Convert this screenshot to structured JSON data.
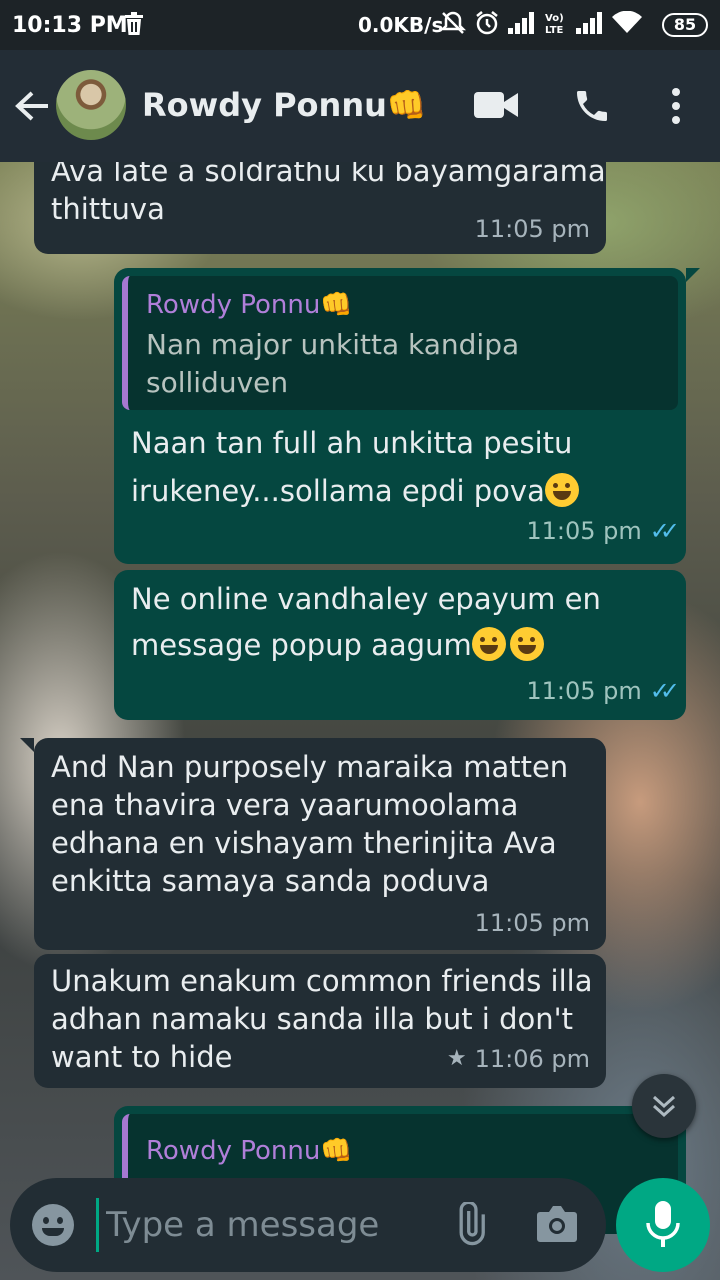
{
  "status_bar": {
    "time": "10:13 PM",
    "net_speed": "0.0KB/s",
    "battery": "85",
    "icons": [
      "trash-icon",
      "mute-icon",
      "alarm-icon",
      "signal-icon",
      "volte-icon",
      "wifi-icon",
      "battery-icon"
    ]
  },
  "header": {
    "contact_name": "Rowdy Ponnu👊"
  },
  "messages": [
    {
      "direction": "in",
      "text_lines": [
        "Ava late a soldrathu ku bayamgarama",
        "thittuva"
      ],
      "time": "11:05 pm"
    },
    {
      "direction": "out",
      "quote": {
        "name": "Rowdy Ponnu👊",
        "text_lines": [
          "Nan major unkitta kandipa",
          "solliduven"
        ]
      },
      "text_lines": [
        "Naan tan full ah unkitta pesitu",
        "irukeney...sollama epdi pova"
      ],
      "time": "11:05 pm",
      "status": "read"
    },
    {
      "direction": "out",
      "text_lines": [
        "Ne online vandhaley epayum en",
        "message popup aagum"
      ],
      "time": "11:05 pm",
      "status": "read"
    },
    {
      "direction": "in",
      "text_lines": [
        "And Nan purposely maraika matten",
        "ena thavira vera yaarumoolama",
        "edhana en vishayam therinjita Ava",
        "enkitta samaya sanda poduva"
      ],
      "time": "11:05 pm"
    },
    {
      "direction": "in",
      "text_lines": [
        "Unakum enakum common friends illa",
        "adhan namaku sanda illa but i don't",
        "want to hide"
      ],
      "time": "11:06 pm",
      "starred": true
    },
    {
      "direction": "out",
      "quote": {
        "name": "Rowdy Ponnu👊"
      }
    }
  ],
  "composer": {
    "placeholder": "Type a message"
  },
  "colors": {
    "incoming_bubble": "#222d34",
    "outgoing_bubble": "#054740",
    "accent": "#00a884",
    "read_ticks": "#53bdeb",
    "quote_name": "#b07fd9"
  }
}
